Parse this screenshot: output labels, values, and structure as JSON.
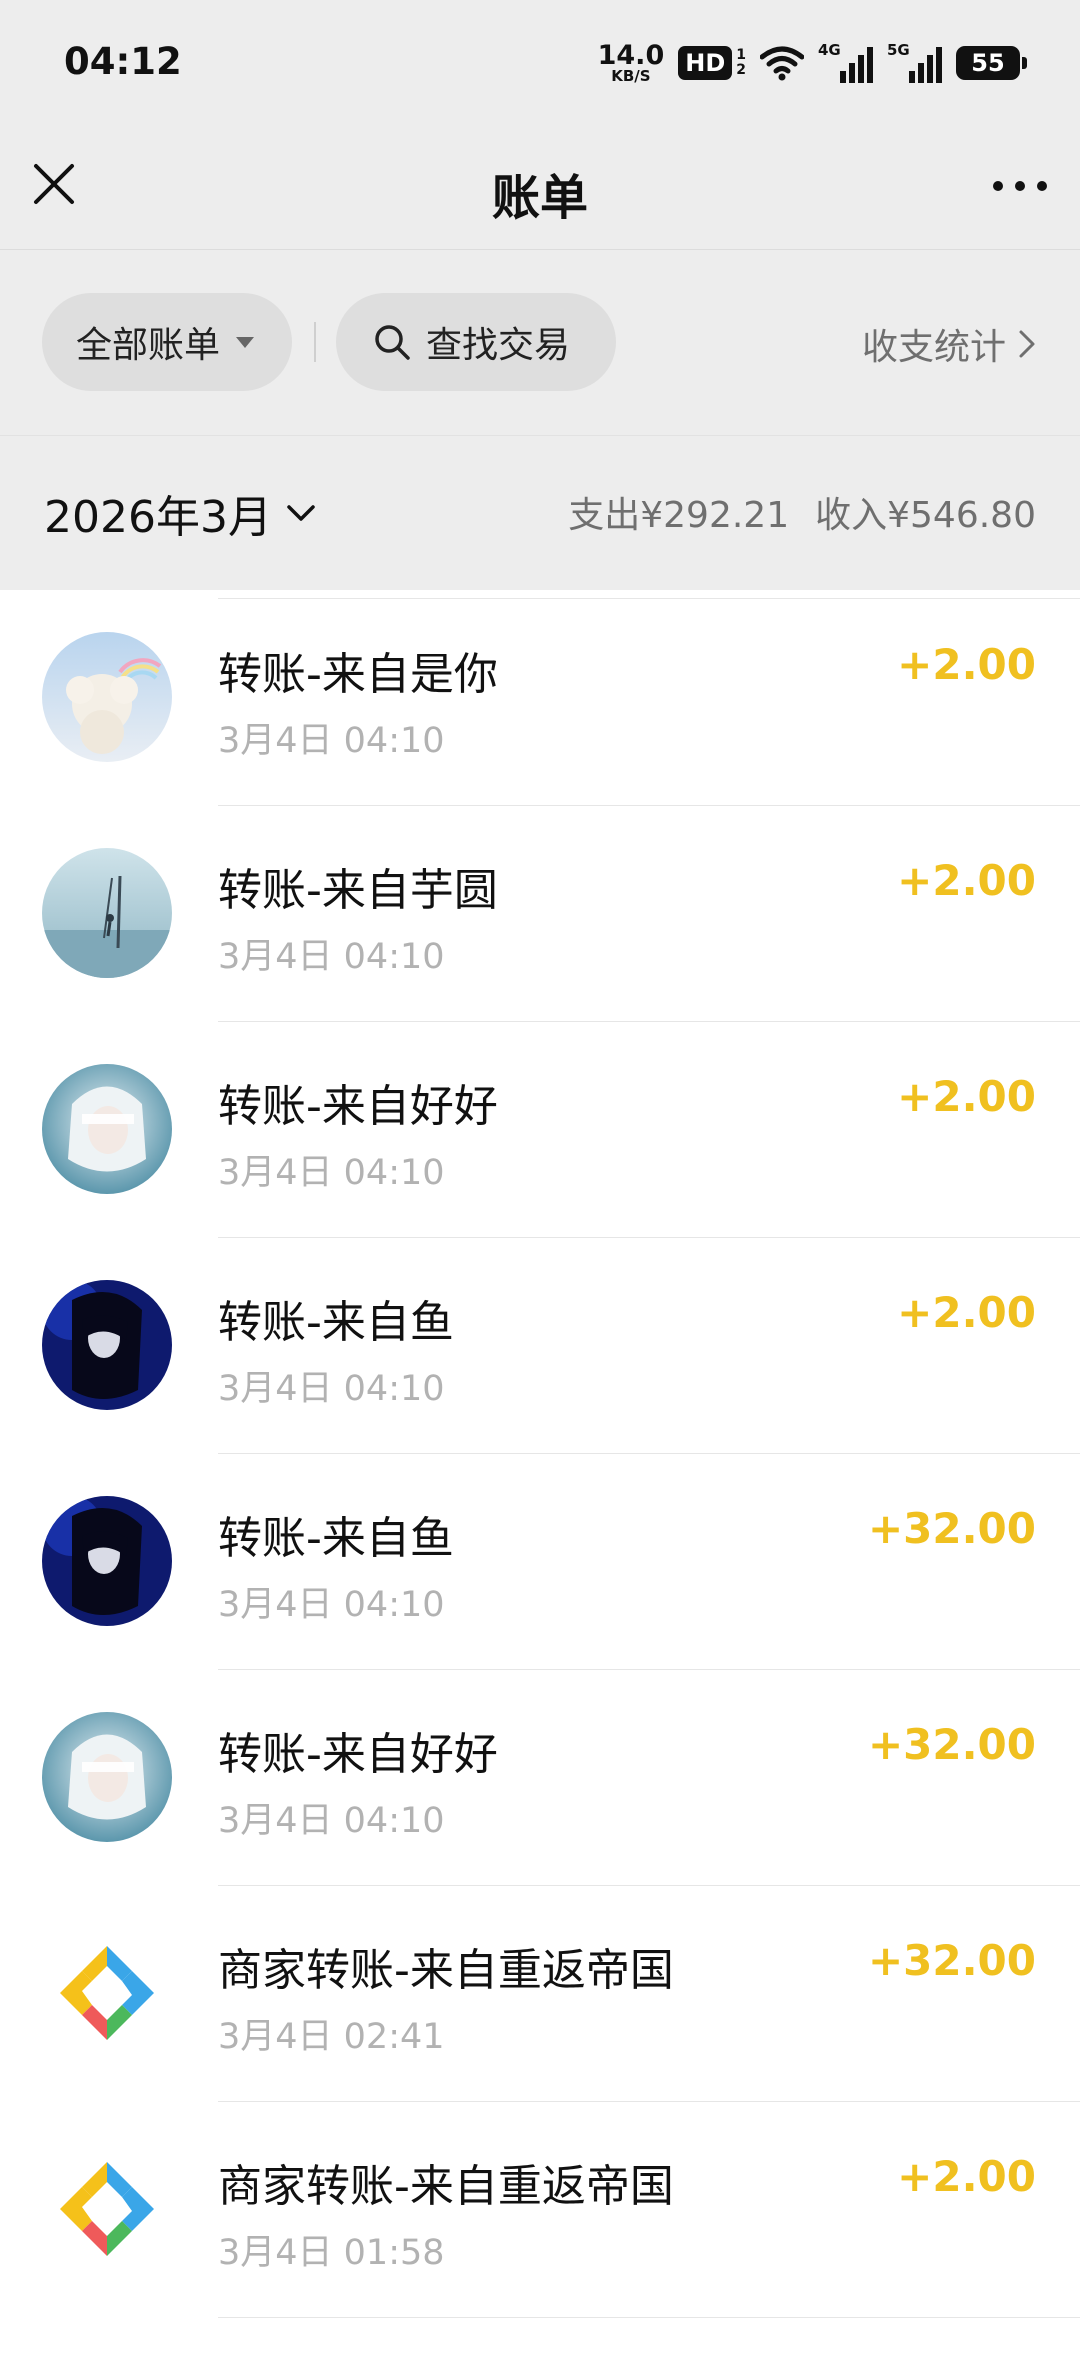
{
  "status_bar": {
    "time": "04:12",
    "net_speed": "14.0",
    "net_unit": "KB/S",
    "hd_label": "HD",
    "hd_sub_1": "1",
    "hd_sub_2": "2",
    "signal_1_label": "4G",
    "signal_2_label": "5G",
    "battery": "55",
    "icons": [
      "wifi-icon",
      "signal-4g-icon",
      "signal-5g-icon",
      "battery-icon"
    ]
  },
  "nav": {
    "title": "账单",
    "close_icon": "close-icon",
    "more_icon": "more-icon"
  },
  "filters": {
    "all_bills": "全部账单",
    "search_label": "查找交易",
    "stats_link": "收支统计"
  },
  "month_header": {
    "month": "2026年3月",
    "expense": "支出¥292.21",
    "income": "收入¥546.80"
  },
  "colors": {
    "income_amount": "#f0c020",
    "page_bg": "#ededed",
    "list_bg": "#ffffff"
  },
  "transactions": [
    {
      "title": "转账-来自是你",
      "time": "3月4日 04:10",
      "amount": "+2.00",
      "avatar": "avatar-cloud"
    },
    {
      "title": "转账-来自芋圆",
      "time": "3月4日 04:10",
      "amount": "+2.00",
      "avatar": "avatar-sea"
    },
    {
      "title": "转账-来自好好",
      "time": "3月4日 04:10",
      "amount": "+2.00",
      "avatar": "avatar-girl-white"
    },
    {
      "title": "转账-来自鱼",
      "time": "3月4日 04:10",
      "amount": "+2.00",
      "avatar": "avatar-girl-dark"
    },
    {
      "title": "转账-来自鱼",
      "time": "3月4日 04:10",
      "amount": "+32.00",
      "avatar": "avatar-girl-dark"
    },
    {
      "title": "转账-来自好好",
      "time": "3月4日 04:10",
      "amount": "+32.00",
      "avatar": "avatar-girl-white"
    },
    {
      "title": "商家转账-来自重返帝国",
      "time": "3月4日 02:41",
      "amount": "+32.00",
      "avatar": "merchant-logo"
    },
    {
      "title": "商家转账-来自重返帝国",
      "time": "3月4日 01:58",
      "amount": "+2.00",
      "avatar": "merchant-logo"
    }
  ]
}
